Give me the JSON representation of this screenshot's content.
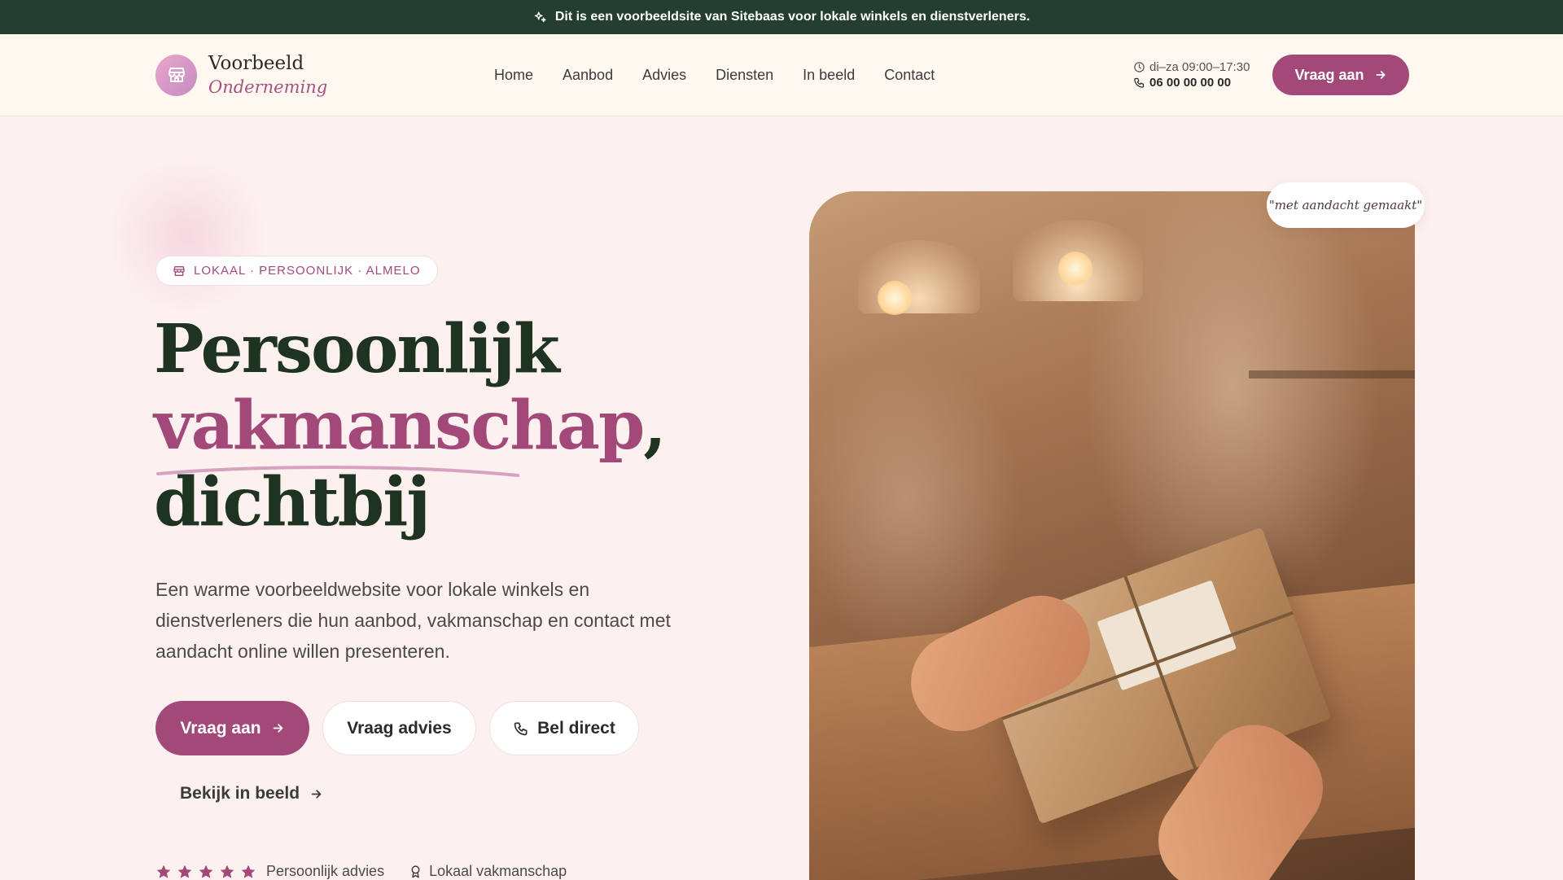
{
  "announcement": {
    "text": "Dit is een voorbeeldsite van Sitebaas voor lokale winkels en dienstverleners."
  },
  "logo": {
    "line1": "Voorbeeld",
    "line2": "Onderneming"
  },
  "nav": {
    "items": [
      {
        "label": "Home"
      },
      {
        "label": "Aanbod"
      },
      {
        "label": "Advies"
      },
      {
        "label": "Diensten"
      },
      {
        "label": "In beeld"
      },
      {
        "label": "Contact"
      }
    ]
  },
  "header": {
    "hours": "di–za 09:00–17:30",
    "phone": "06 00 00 00 00",
    "cta_label": "Vraag aan"
  },
  "hero": {
    "tag": "LOKAAL · PERSOONLIJK · ALMELO",
    "headline_line1": "Persoonlijk",
    "headline_accent": "vakmanschap",
    "headline_comma": ",",
    "headline_line3": "dichtbij",
    "intro": "Een warme voorbeeldwebsite voor lokale winkels en dienstverleners die hun aanbod, vakmanschap en contact met aandacht online willen presenteren.",
    "buttons": {
      "primary": "Vraag aan",
      "advies": "Vraag advies",
      "bel": "Bel direct"
    },
    "link": "Bekijk in beeld",
    "trust": {
      "stars": 5,
      "advice": "Persoonlijk advies",
      "craft": "Lokaal vakmanschap"
    },
    "quote": "\"met aandacht gemaakt\""
  },
  "colors": {
    "announcement_bg": "#243f2f",
    "accent": "#a2497a",
    "headline": "#1f3323",
    "background": "#fdf1ef"
  }
}
